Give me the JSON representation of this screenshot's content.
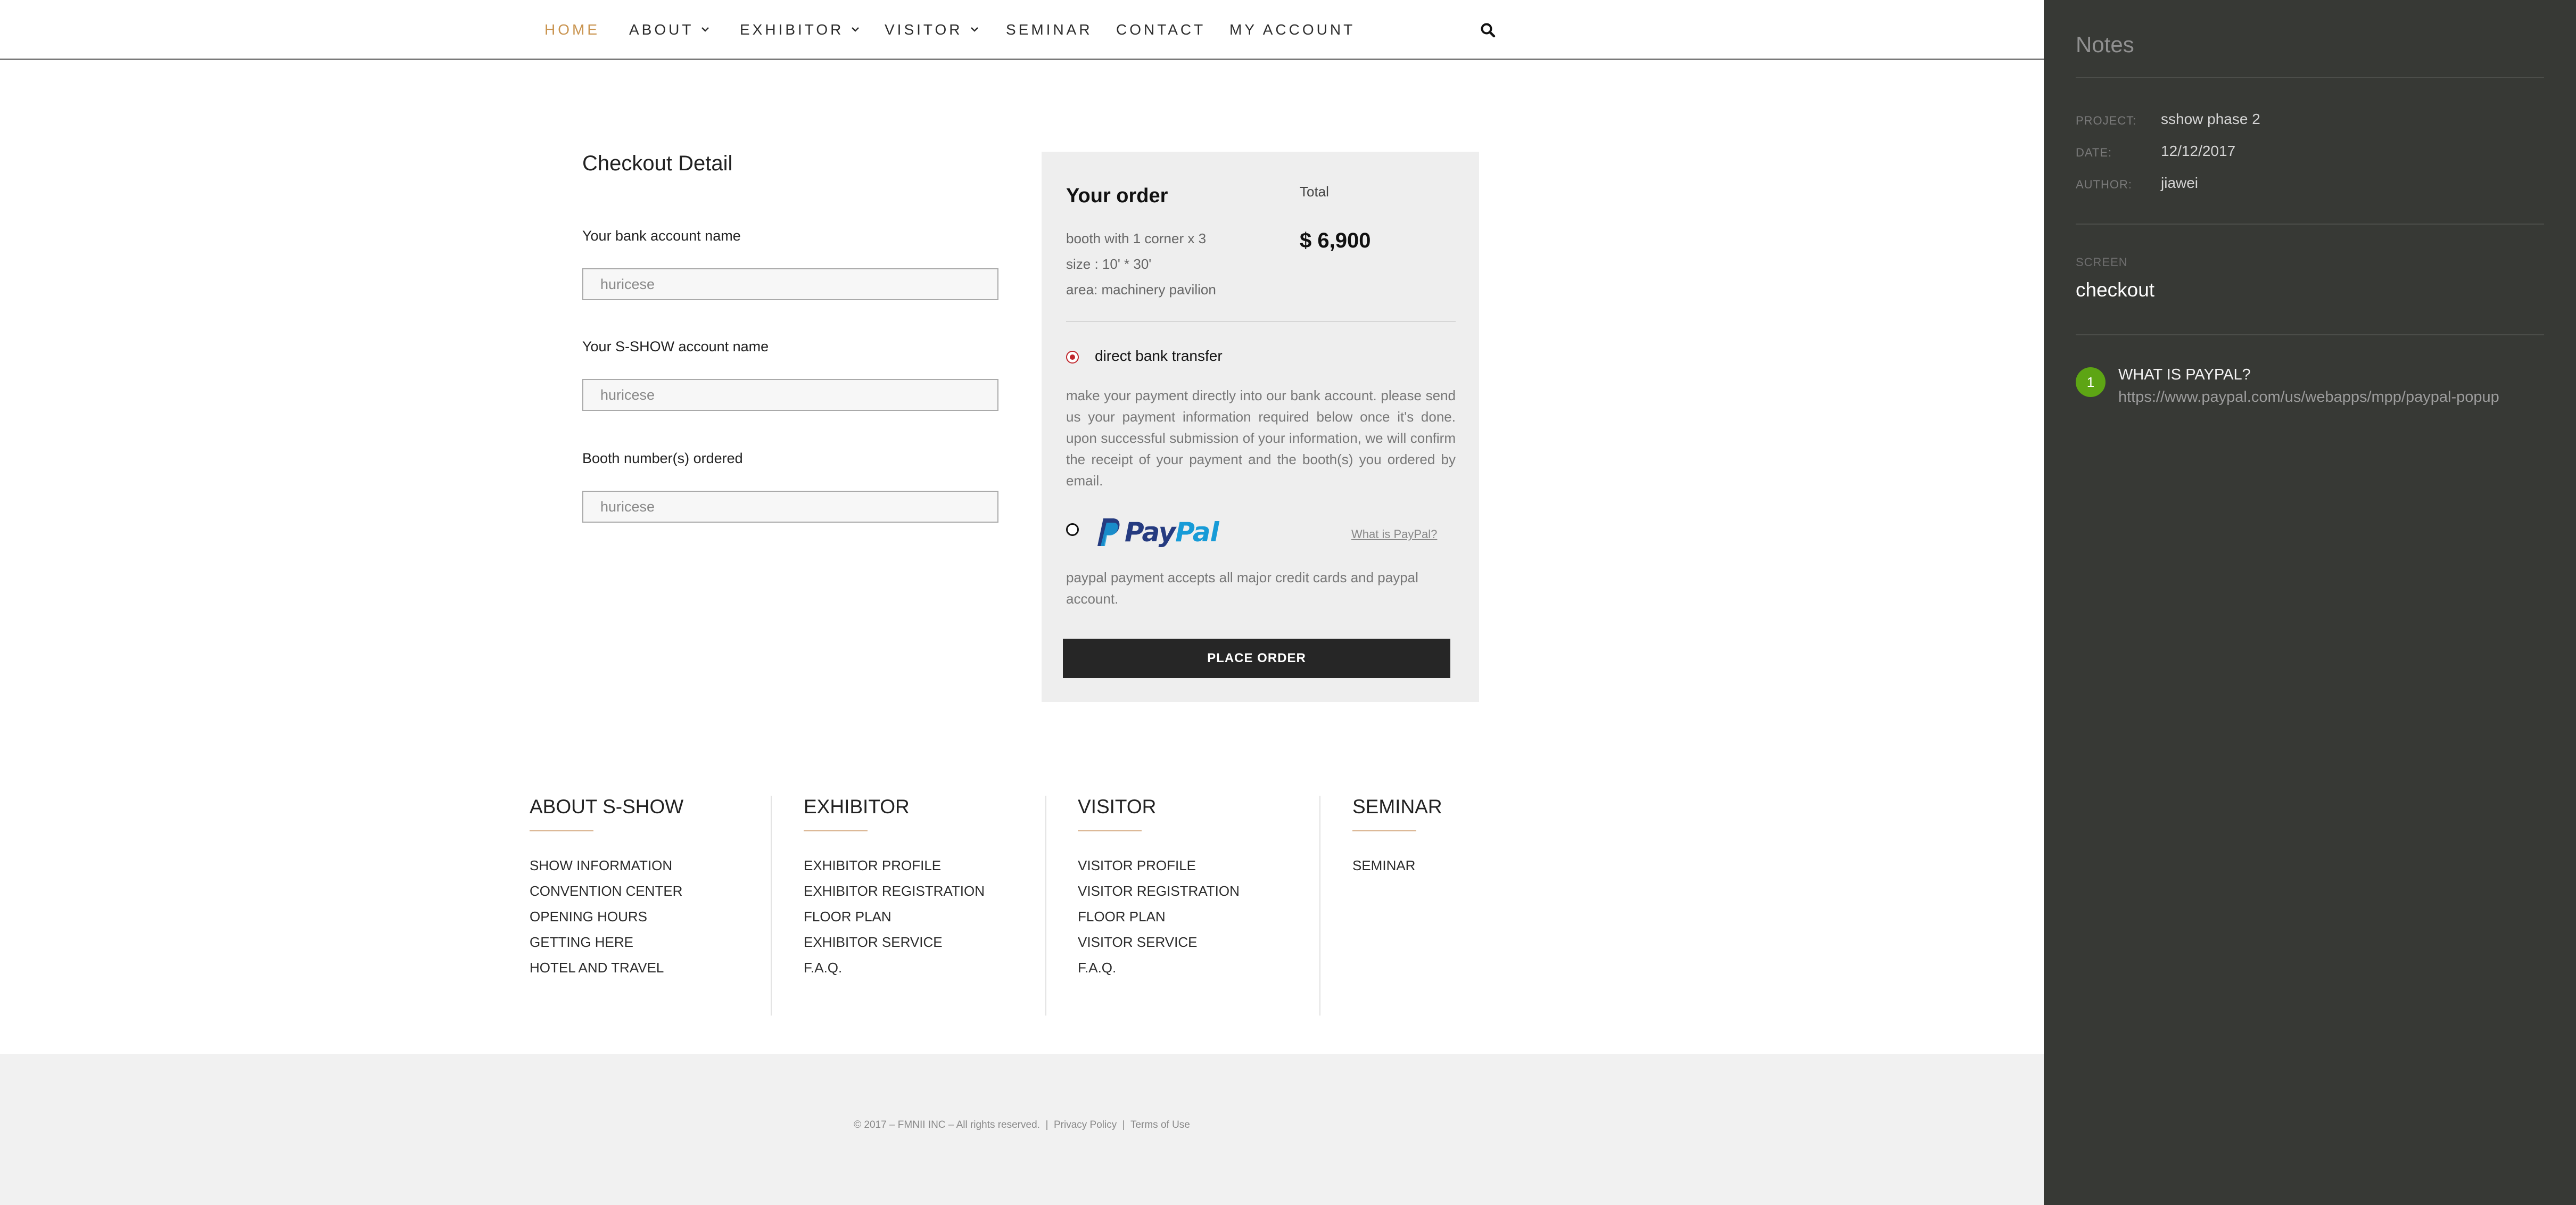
{
  "nav": {
    "items": [
      {
        "label": "HOME",
        "active": true,
        "has_dropdown": false
      },
      {
        "label": "ABOUT",
        "active": false,
        "has_dropdown": true
      },
      {
        "label": "EXHIBITOR",
        "active": false,
        "has_dropdown": true
      },
      {
        "label": "VISITOR",
        "active": false,
        "has_dropdown": true
      },
      {
        "label": "SEMINAR",
        "active": false,
        "has_dropdown": false
      },
      {
        "label": "CONTACT",
        "active": false,
        "has_dropdown": false
      },
      {
        "label": "MY ACCOUNT",
        "active": false,
        "has_dropdown": false
      }
    ],
    "search_icon": "search-icon",
    "active_color": "#c9934e"
  },
  "checkout": {
    "title": "Checkout Detail",
    "fields": [
      {
        "label": "Your bank account name",
        "placeholder": "huricese",
        "value": ""
      },
      {
        "label": "Your S-SHOW account name",
        "placeholder": "huricese",
        "value": ""
      },
      {
        "label": "Booth number(s) ordered",
        "placeholder": "huricese",
        "value": ""
      }
    ]
  },
  "order": {
    "title": "Your order",
    "total_label": "Total",
    "item_lines": [
      "booth with 1 corner  x 3",
      "size :  10' * 30'",
      "area:  machinery pavilion"
    ],
    "total_price": "$ 6,900",
    "bank_transfer": {
      "label": "direct bank transfer",
      "selected": true,
      "description": "make your payment directly into our bank account. please send us your payment information required below once it's done. upon successful submission of your information, we will confirm the receipt of your payment and the booth(s) you ordered by email."
    },
    "paypal": {
      "selected": false,
      "logo_text_pay": "Pay",
      "logo_text_pal": "Pal",
      "what_link": "What is PayPal?",
      "description": "paypal payment accepts all major credit cards and paypal account."
    },
    "place_order_label": "PLACE ORDER"
  },
  "footer": {
    "columns": [
      {
        "title": "ABOUT S-SHOW",
        "links": [
          "SHOW INFORMATION",
          "CONVENTION CENTER",
          "OPENING HOURS",
          "GETTING HERE",
          "HOTEL AND TRAVEL"
        ]
      },
      {
        "title": "EXHIBITOR",
        "links": [
          "EXHIBITOR PROFILE",
          "EXHIBITOR REGISTRATION",
          "FLOOR PLAN",
          "EXHIBITOR SERVICE",
          "F.A.Q."
        ]
      },
      {
        "title": "VISITOR",
        "links": [
          "VISITOR PROFILE",
          "VISITOR REGISTRATION",
          "FLOOR PLAN",
          "VISITOR SERVICE",
          "F.A.Q."
        ]
      },
      {
        "title": "SEMINAR",
        "links": [
          "SEMINAR"
        ]
      }
    ],
    "copyright": "© 2017 – FMNII INC – All rights reserved.",
    "privacy": "Privacy Policy",
    "terms": "Terms of Use",
    "separator": "|"
  },
  "notes": {
    "title": "Notes",
    "meta": [
      {
        "label": "PROJECT:",
        "value": "sshow phase 2"
      },
      {
        "label": "DATE:",
        "value": "12/12/2017"
      },
      {
        "label": "AUTHOR:",
        "value": "jiawei"
      }
    ],
    "screen_label": "SCREEN",
    "screen_value": "checkout",
    "annotations": [
      {
        "number": "1",
        "title": "WHAT IS PAYPAL?",
        "url": "https://www.paypal.com/us/webapps/mpp/paypal-popup"
      }
    ],
    "badge_color": "#5da514"
  }
}
